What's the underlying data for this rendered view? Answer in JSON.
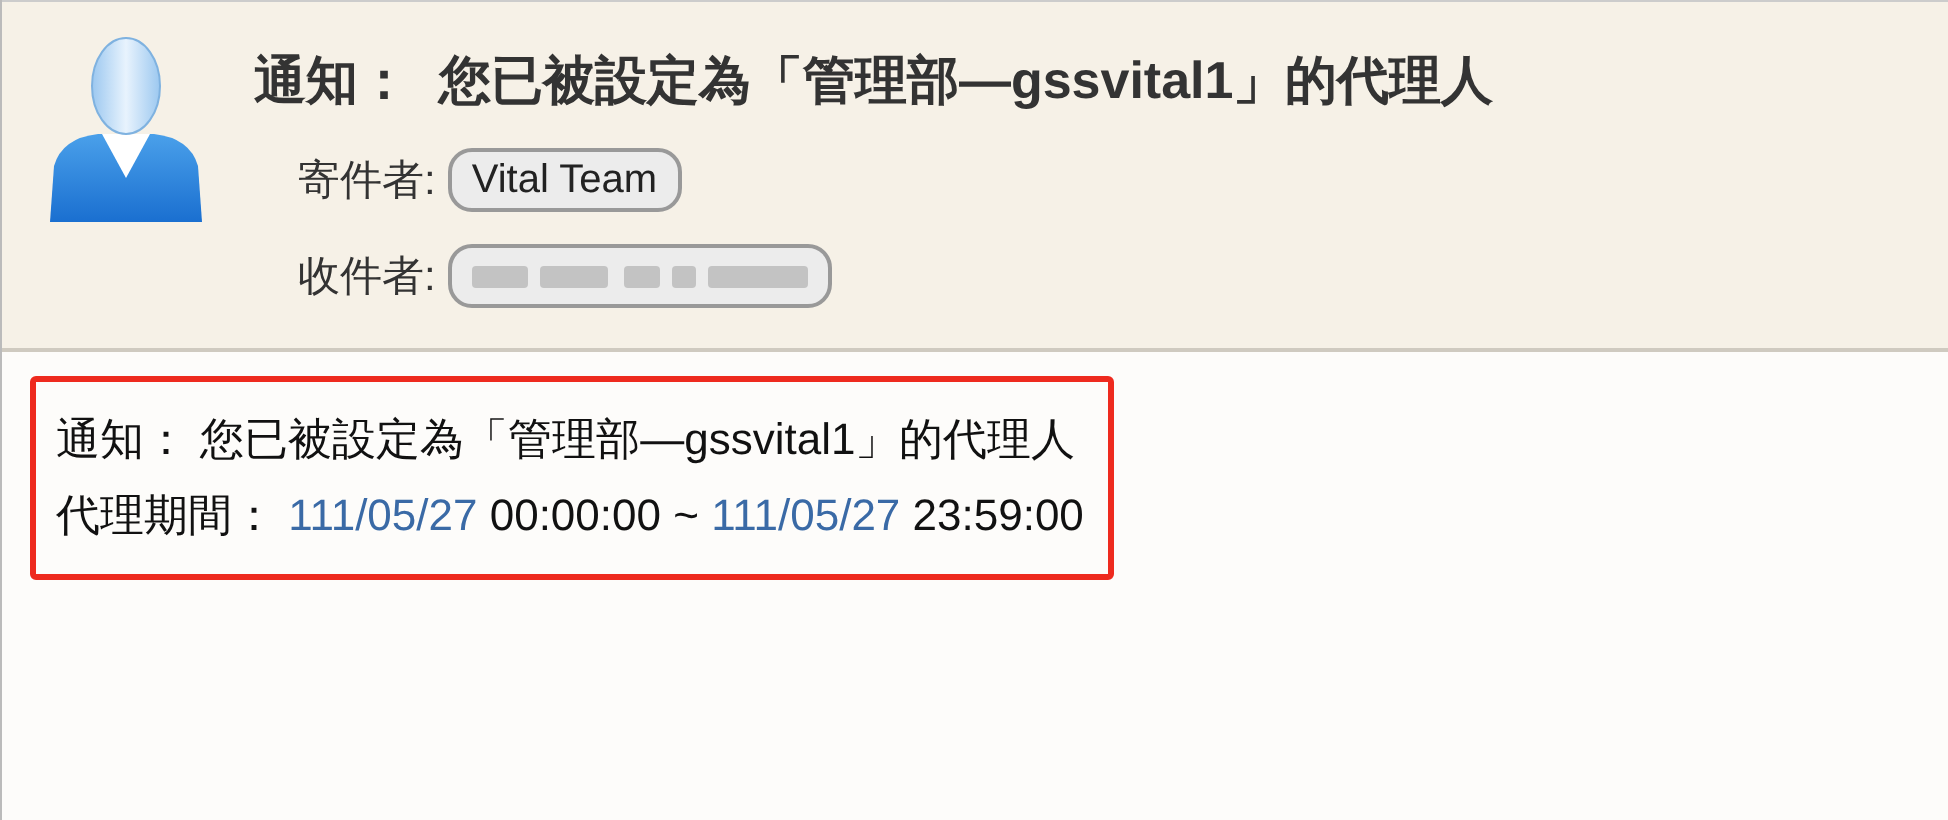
{
  "header": {
    "title": "通知：  您已被設定為「管理部—gssvital1」的代理人",
    "fields": [
      {
        "label": "寄件者:",
        "value": "Vital Team",
        "redacted": false
      },
      {
        "label": "收件者:",
        "redacted": true
      }
    ]
  },
  "body": {
    "highlighted": true,
    "lines": [
      {
        "parts": [
          {
            "kind": "text",
            "text": "通知： 您已被設定為「管理部—gssvital1」的代理人"
          }
        ]
      },
      {
        "parts": [
          {
            "kind": "text",
            "text": "代理期間： "
          },
          {
            "kind": "link",
            "text": "111/05/27"
          },
          {
            "kind": "text",
            "text": " 00:00:00 ~ "
          },
          {
            "kind": "link",
            "text": "111/05/27"
          },
          {
            "kind": "text",
            "text": " 23:59:00"
          }
        ]
      }
    ]
  }
}
